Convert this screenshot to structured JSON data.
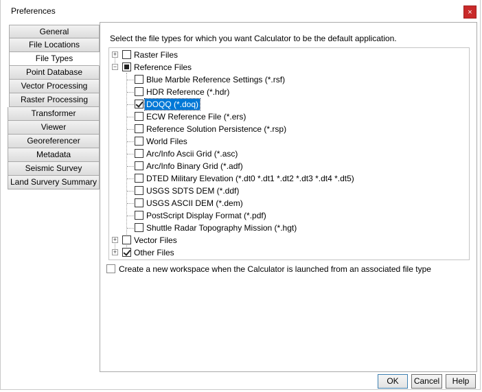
{
  "window": {
    "title": "Preferences",
    "close_glyph": "×"
  },
  "tabs": [
    {
      "label": "General",
      "active": false
    },
    {
      "label": "File Locations",
      "active": false
    },
    {
      "label": "File Types",
      "active": true
    },
    {
      "label": "Point Database",
      "active": false
    },
    {
      "label": "Vector Processing",
      "active": false
    },
    {
      "label": "Raster Processing",
      "active": false
    },
    {
      "label": "Transformer",
      "active": false
    },
    {
      "label": "Viewer",
      "active": false
    },
    {
      "label": "Georeferencer",
      "active": false
    },
    {
      "label": "Metadata",
      "active": false
    },
    {
      "label": "Seismic Survey",
      "active": false
    },
    {
      "label": "Land Survery Summary",
      "active": false
    }
  ],
  "panel": {
    "instruction": "Select the file types for which you want Calculator to be the default application.",
    "tree": {
      "raster": {
        "label": "Raster Files",
        "state": "unchecked",
        "expander": "+"
      },
      "reference": {
        "label": "Reference Files",
        "state": "partial",
        "expander": "−",
        "children": [
          {
            "label": "Blue Marble Reference Settings (*.rsf)",
            "checked": false
          },
          {
            "label": "HDR Reference (*.hdr)",
            "checked": false
          },
          {
            "label": "DOQQ (*.doq)",
            "checked": true,
            "selected": true
          },
          {
            "label": "ECW Reference File (*.ers)",
            "checked": false
          },
          {
            "label": "Reference Solution Persistence (*.rsp)",
            "checked": false
          },
          {
            "label": "World Files",
            "checked": false
          },
          {
            "label": "Arc/Info Ascii Grid (*.asc)",
            "checked": false
          },
          {
            "label": "Arc/Info Binary Grid (*.adf)",
            "checked": false
          },
          {
            "label": "DTED Military Elevation (*.dt0 *.dt1 *.dt2 *.dt3 *.dt4 *.dt5)",
            "checked": false
          },
          {
            "label": "USGS SDTS DEM (*.ddf)",
            "checked": false
          },
          {
            "label": "USGS ASCII DEM (*.dem)",
            "checked": false
          },
          {
            "label": "PostScript Display Format (*.pdf)",
            "checked": false
          },
          {
            "label": "Shuttle Radar Topography Mission (*.hgt)",
            "checked": false
          }
        ]
      },
      "vector": {
        "label": "Vector Files",
        "state": "unchecked",
        "expander": "+"
      },
      "other": {
        "label": "Other Files",
        "state": "checked",
        "expander": "+"
      }
    },
    "workspace_option": {
      "label": "Create a new workspace when the Calculator is launched from an associated file type",
      "checked": false
    }
  },
  "buttons": {
    "ok": "OK",
    "cancel": "Cancel",
    "help": "Help"
  },
  "colors": {
    "selection": "#0078d7",
    "close_button": "#c92a2a"
  },
  "icons": {
    "close": "close-icon",
    "expand": "plus-expander-icon",
    "collapse": "minus-expander-icon",
    "checkbox": "checkbox-icon"
  }
}
